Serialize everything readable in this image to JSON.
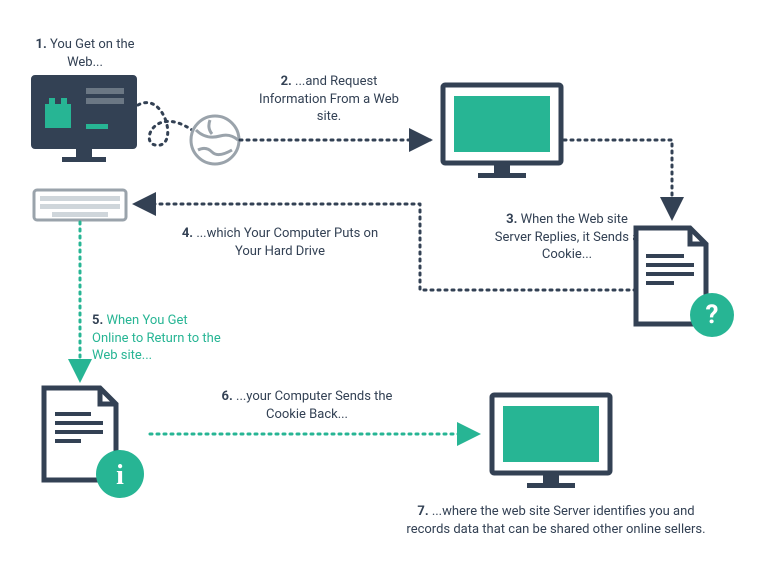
{
  "steps": {
    "s1": {
      "num": "1.",
      "text": "You Get on the Web..."
    },
    "s2": {
      "num": "2.",
      "text": "...and Request Information From a Web site."
    },
    "s3": {
      "num": "3.",
      "text": "When the Web site Server Replies, it Sends a Cookie..."
    },
    "s4": {
      "num": "4.",
      "text": "...which Your Computer Puts on Your Hard Drive"
    },
    "s5": {
      "num": "5.",
      "text": "When You Get Online to Return to the Web site..."
    },
    "s6": {
      "num": "6.",
      "text": "...your Computer Sends the Cookie Back..."
    },
    "s7": {
      "num": "7.",
      "text": "...where the web site Server identifies you and records data that can be shared other online sellers."
    }
  },
  "icons": {
    "question": "?",
    "info": "i"
  }
}
